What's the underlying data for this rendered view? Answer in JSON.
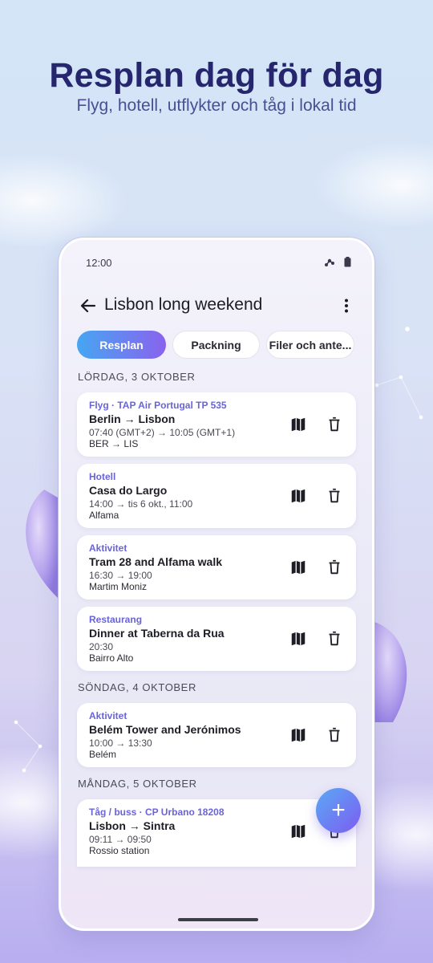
{
  "hero": {
    "title": "Resplan dag för dag",
    "subtitle": "Flyg, hotell, utflykter och tåg i lokal tid"
  },
  "status_bar": {
    "time": "12:00",
    "icons": [
      "signal-icon",
      "battery-icon"
    ]
  },
  "app_bar": {
    "back_icon": "arrow-left-icon",
    "title": "Lisbon long weekend",
    "menu_icon": "more-vertical-icon"
  },
  "tabs": [
    {
      "label": "Resplan",
      "active": true
    },
    {
      "label": "Packning",
      "active": false
    },
    {
      "label": "Filer och ante...",
      "active": false
    }
  ],
  "days": [
    {
      "header": "LÖRDAG, 3 OKTOBER",
      "items": [
        {
          "category": "Flyg · TAP Air Portugal TP 535",
          "title": "Berlin → Lisbon",
          "time": "07:40 (GMT+2) → 10:05 (GMT+1)",
          "place": "BER → LIS"
        },
        {
          "category": "Hotell",
          "title": "Casa do Largo",
          "time": "14:00 → tis 6 okt., 11:00",
          "place": "Alfama"
        },
        {
          "category": "Aktivitet",
          "title": "Tram 28 and Alfama walk",
          "time": "16:30 → 19:00",
          "place": "Martim Moniz"
        },
        {
          "category": "Restaurang",
          "title": "Dinner at Taberna da Rua",
          "time": "20:30",
          "place": "Bairro Alto"
        }
      ]
    },
    {
      "header": "SÖNDAG, 4 OKTOBER",
      "items": [
        {
          "category": "Aktivitet",
          "title": "Belém Tower and Jerónimos",
          "time": "10:00 → 13:30",
          "place": "Belém"
        }
      ]
    },
    {
      "header": "MÅNDAG, 5 OKTOBER",
      "items": [
        {
          "category": "Tåg / buss · CP Urbano 18208",
          "title": "Lisbon → Sintra",
          "time": "09:11 → 09:50",
          "place": "Rossio station"
        }
      ]
    }
  ],
  "card_icons": {
    "map": "map-icon",
    "delete": "trash-icon"
  },
  "fab": {
    "icon": "plus-icon",
    "glyph": "+"
  },
  "colors": {
    "accent_start": "#46a6f2",
    "accent_end": "#8a62ee",
    "category": "#6a64d8",
    "headline": "#26266e"
  }
}
